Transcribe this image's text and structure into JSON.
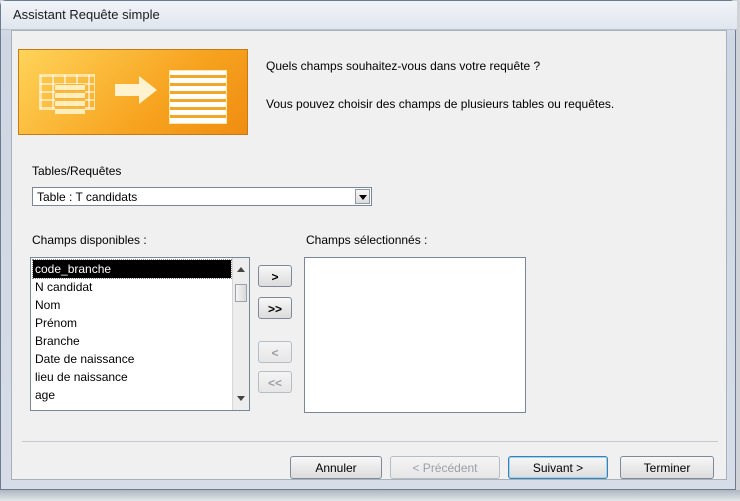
{
  "window": {
    "title": "Assistant Requête simple"
  },
  "intro": {
    "question": "Quels champs souhaitez-vous dans votre requête ?",
    "hint": "Vous pouvez choisir des champs de plusieurs tables ou requêtes."
  },
  "source": {
    "label": "Tables/Requêtes",
    "selected": "Table : T candidats"
  },
  "available": {
    "label": "Champs disponibles :",
    "items": [
      "code_branche",
      "N candidat",
      "Nom",
      "Prénom",
      "Branche",
      "Date de naissance",
      "lieu de naissance",
      "age"
    ],
    "selected_index": 0
  },
  "chosen": {
    "label": "Champs sélectionnés :",
    "items": []
  },
  "move_buttons": {
    "add_one": ">",
    "add_all": ">>",
    "remove_one": "<",
    "remove_all": "<<"
  },
  "footer": {
    "cancel": "Annuler",
    "back": "< Précédent",
    "next": "Suivant >",
    "finish": "Terminer"
  }
}
